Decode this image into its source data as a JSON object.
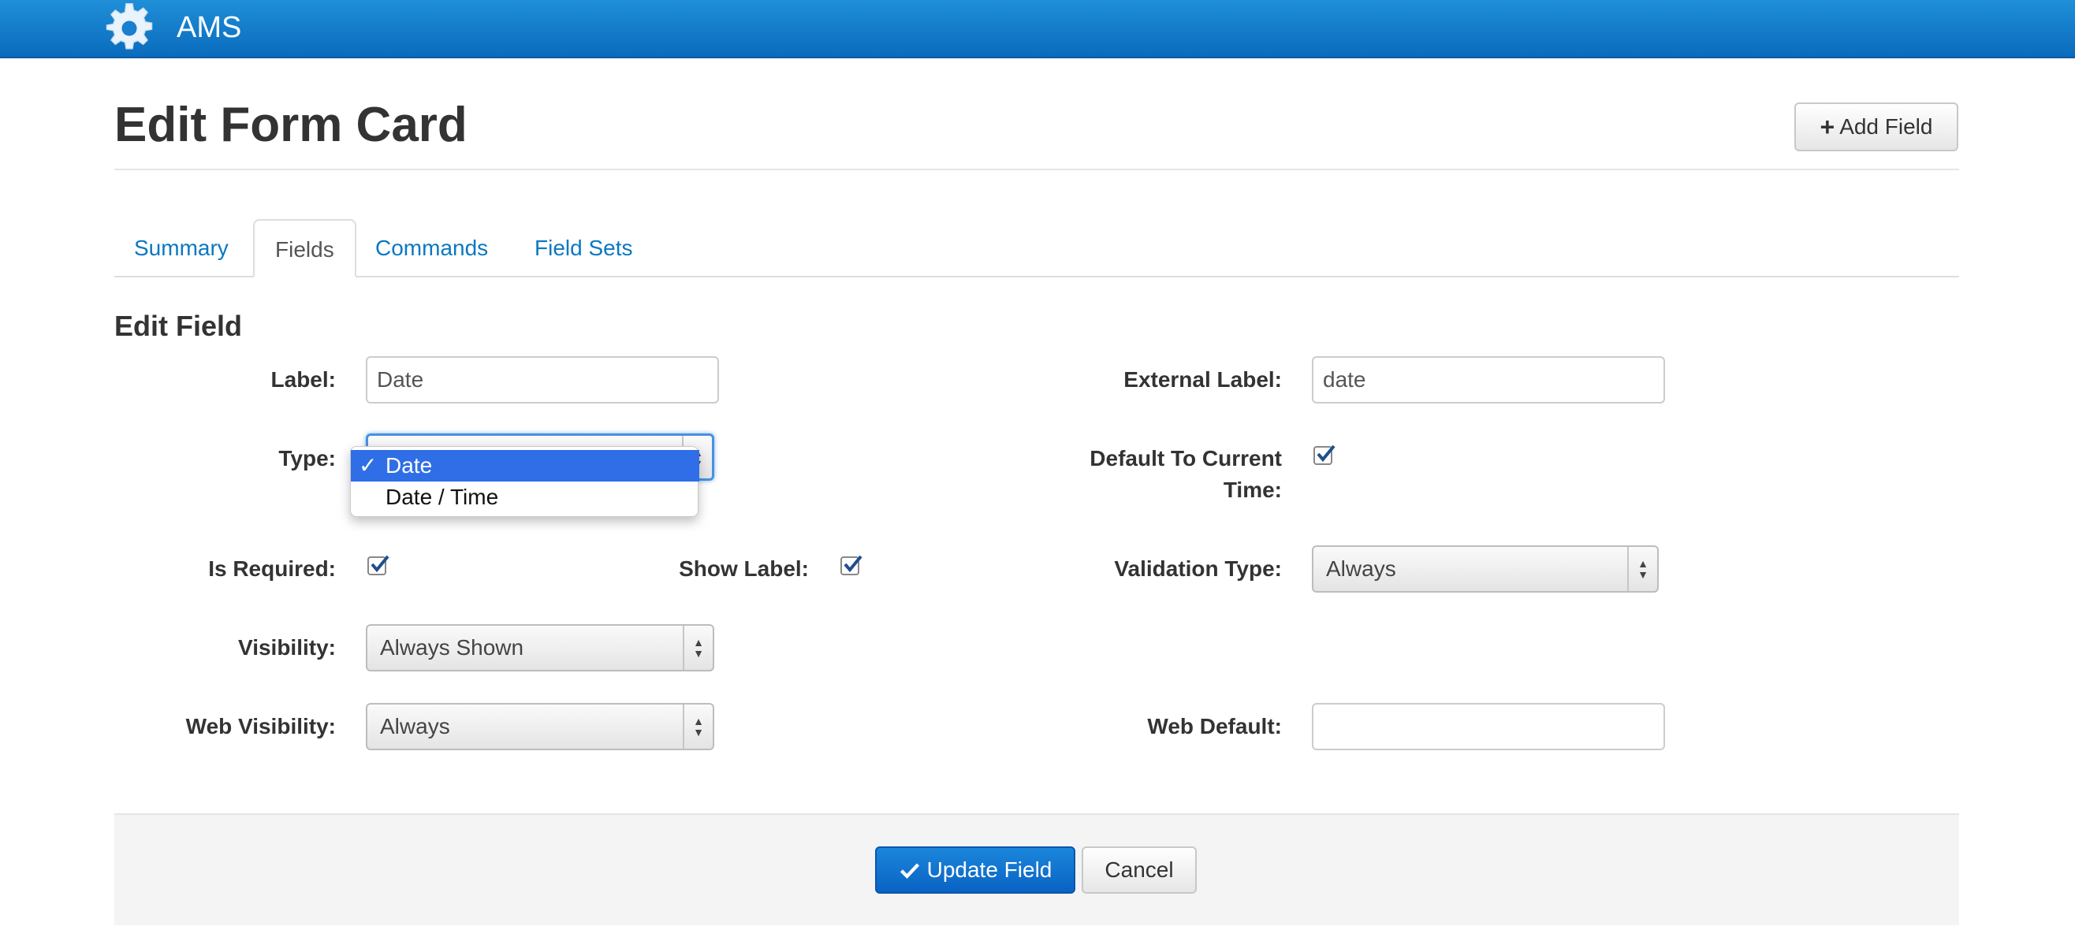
{
  "navbar": {
    "brand": "AMS",
    "brand_icon": "gear-icon"
  },
  "page": {
    "title": "Edit Form Card",
    "add_field_label": "Add Field",
    "add_field_icon": "plus-icon"
  },
  "tabs": [
    {
      "label": "Summary",
      "active": false
    },
    {
      "label": "Fields",
      "active": true
    },
    {
      "label": "Commands",
      "active": false
    },
    {
      "label": "Field Sets",
      "active": false
    }
  ],
  "form": {
    "section_title": "Edit Field",
    "label": {
      "label": "Label:",
      "value": "Date"
    },
    "external_label": {
      "label": "External Label:",
      "value": "date"
    },
    "type": {
      "label": "Type:",
      "options": [
        "Date",
        "Date / Time"
      ],
      "selected": "Date"
    },
    "default_to_current_time": {
      "label_line1": "Default To Current",
      "label_line2": "Time:",
      "checked": true
    },
    "is_required": {
      "label": "Is Required:",
      "checked": true
    },
    "show_label": {
      "label": "Show Label:",
      "checked": true
    },
    "validation_type": {
      "label": "Validation Type:",
      "value": "Always"
    },
    "visibility": {
      "label": "Visibility:",
      "value": "Always Shown"
    },
    "web_visibility": {
      "label": "Web Visibility:",
      "value": "Always"
    },
    "web_default": {
      "label": "Web Default:",
      "value": ""
    }
  },
  "footer": {
    "update_label": "Update Field",
    "update_icon": "check-icon",
    "cancel_label": "Cancel"
  },
  "colors": {
    "navbar": "#0a6bbd",
    "link": "#0a78c2",
    "primary": "#0a62c4",
    "dropdown_highlight": "#2f6ee6"
  }
}
